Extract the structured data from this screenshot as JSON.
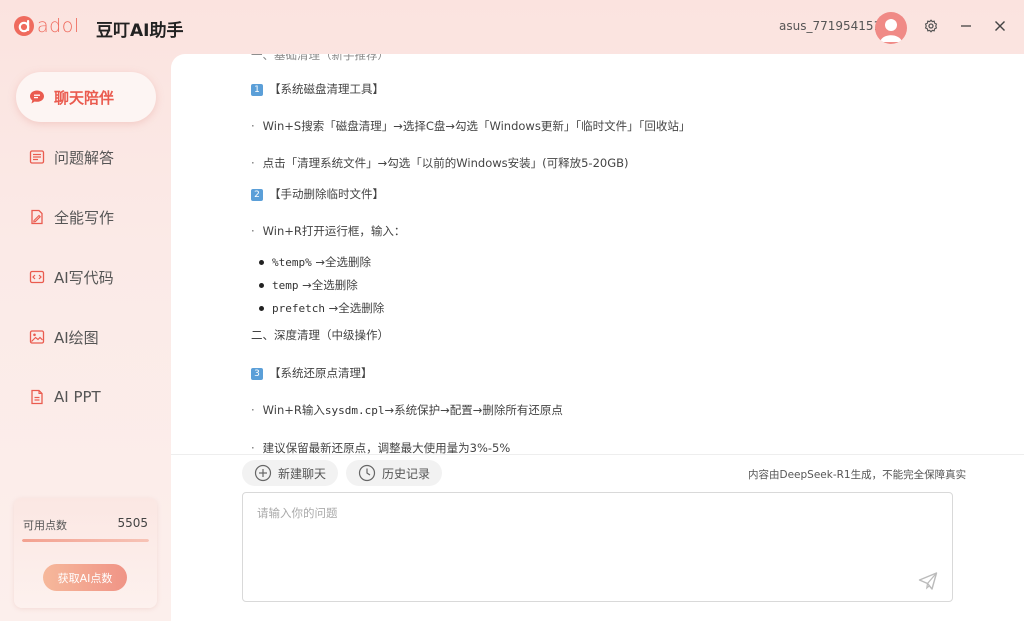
{
  "app": {
    "logo_text": "adol",
    "title": "豆叮AI助手",
    "user_name": "asus_771954151"
  },
  "sidebar": {
    "items": [
      {
        "label": "聊天陪伴",
        "icon": "chat-bubble-icon",
        "active": true
      },
      {
        "label": "问题解答",
        "icon": "document-list-icon",
        "active": false
      },
      {
        "label": "全能写作",
        "icon": "pen-document-icon",
        "active": false
      },
      {
        "label": "AI写代码",
        "icon": "code-icon",
        "active": false
      },
      {
        "label": "AI绘图",
        "icon": "image-icon",
        "active": false
      },
      {
        "label": "AI PPT",
        "icon": "ppt-file-icon",
        "active": false
      }
    ]
  },
  "points": {
    "label": "可用点数",
    "value": "5505",
    "progress": 1.0,
    "button_label": "获取AI点数"
  },
  "chat": {
    "lines": [
      {
        "type": "heading",
        "num": "1",
        "text": "【系统磁盘清理工具】"
      },
      {
        "type": "item",
        "text": "Win+S搜索「磁盘清理」→选择C盘→勾选「Windows更新」「临时文件」「回收站」"
      },
      {
        "type": "item",
        "text": "点击「清理系统文件」→勾选「以前的Windows安装」(可释放5-20GB)"
      },
      {
        "type": "heading",
        "num": "2",
        "text": "【手动删除临时文件】"
      },
      {
        "type": "item",
        "text": "Win+R打开运行框，输入："
      },
      {
        "type": "bullet",
        "code": "%temp%",
        "text": "→全选删除"
      },
      {
        "type": "bullet",
        "code": "temp",
        "text": "→全选删除"
      },
      {
        "type": "bullet",
        "code": "prefetch",
        "text": "→全选删除"
      },
      {
        "type": "section",
        "text": "二、深度清理（中级操作）"
      },
      {
        "type": "heading",
        "num": "3",
        "text": "【系统还原点清理】"
      },
      {
        "type": "item-code",
        "pre": "Win+R输入",
        "code": "sysdm.cpl",
        "post": "→系统保护→配置→删除所有还原点"
      },
      {
        "type": "item",
        "text": "建议保留最新还原点，调整最大使用量为3%-5%"
      }
    ]
  },
  "toolbar": {
    "new_chat_label": "新建聊天",
    "history_label": "历史记录",
    "disclaimer": "内容由DeepSeek-R1生成，不能完全保障真实"
  },
  "input": {
    "placeholder": "请输入你的问题"
  },
  "colors": {
    "accent": "#ea5b4f",
    "badge": "#5b9fd8"
  }
}
